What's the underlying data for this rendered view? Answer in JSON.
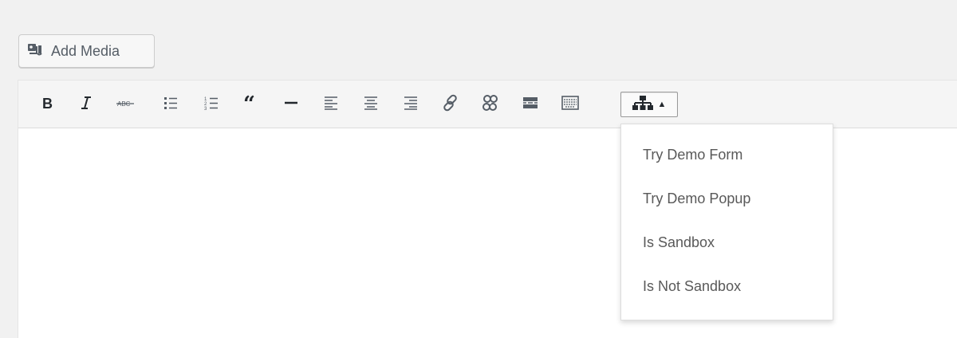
{
  "media_button": {
    "label": "Add Media",
    "icon": "add-media-icon"
  },
  "toolbar": {
    "buttons": [
      {
        "name": "bold",
        "icon": "bold-icon"
      },
      {
        "name": "italic",
        "icon": "italic-icon"
      },
      {
        "name": "strikethrough",
        "icon": "strikethrough-icon"
      },
      {
        "name": "bulleted-list",
        "icon": "bulleted-list-icon"
      },
      {
        "name": "numbered-list",
        "icon": "numbered-list-icon"
      },
      {
        "name": "blockquote",
        "icon": "blockquote-icon"
      },
      {
        "name": "horizontal-line",
        "icon": "horizontal-line-icon"
      },
      {
        "name": "align-left",
        "icon": "align-left-icon"
      },
      {
        "name": "align-center",
        "icon": "align-center-icon"
      },
      {
        "name": "align-right",
        "icon": "align-right-icon"
      },
      {
        "name": "insert-link",
        "icon": "link-icon"
      },
      {
        "name": "remove-link",
        "icon": "unlink-icon"
      },
      {
        "name": "read-more",
        "icon": "read-more-icon"
      },
      {
        "name": "toolbar-toggle",
        "icon": "keyboard-icon"
      },
      {
        "name": "sitemap-dropdown",
        "icon": "sitemap-icon",
        "active": true
      }
    ]
  },
  "dropdown": {
    "items": [
      {
        "label": "Try Demo Form"
      },
      {
        "label": "Try Demo Popup"
      },
      {
        "label": "Is Sandbox"
      },
      {
        "label": "Is Not Sandbox"
      }
    ]
  },
  "colors": {
    "page_bg": "#f1f1f1",
    "toolbar_bg": "#f5f5f5",
    "editor_bg": "#ffffff",
    "icon": "#555d66",
    "menu_text": "#595959"
  }
}
